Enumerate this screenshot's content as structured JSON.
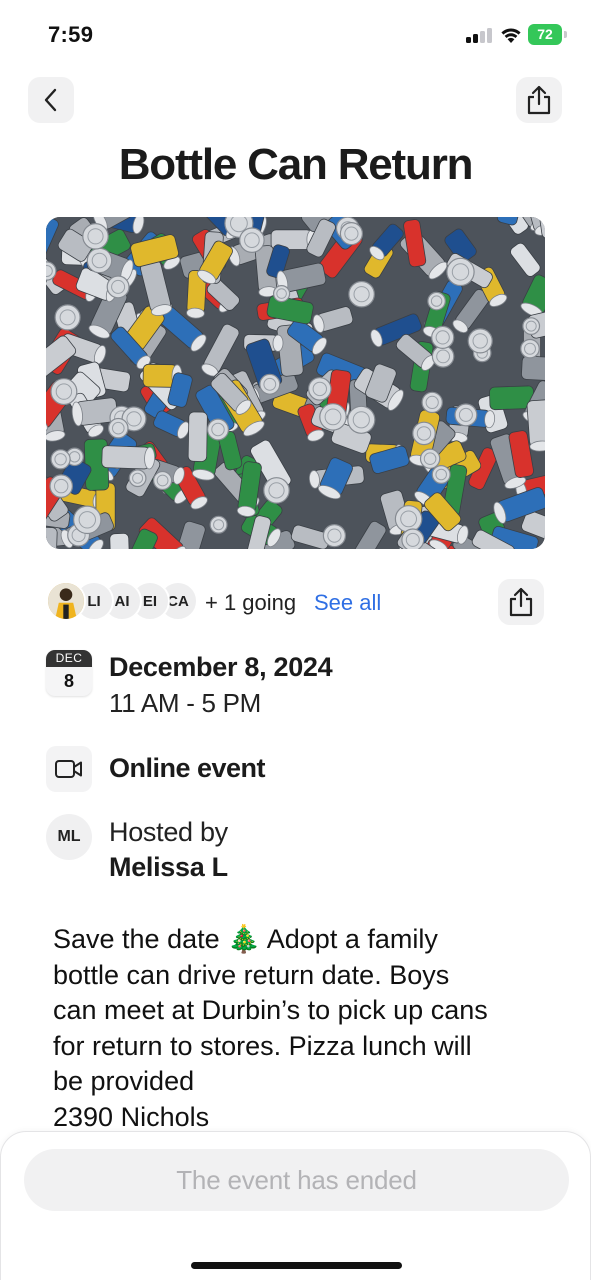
{
  "status_bar": {
    "time": "7:59",
    "battery": "72",
    "battery_color": "#34c759",
    "icons": [
      "signal-icon",
      "wifi-icon",
      "battery-icon"
    ]
  },
  "nav": {
    "back_icon": "chevron-left-icon",
    "share_icon": "share-icon"
  },
  "event": {
    "title": "Bottle Can Return",
    "hero_image": "pile of crushed aluminum soda cans"
  },
  "attendees": {
    "avatars": [
      "LI",
      "AI",
      "EI",
      "CA"
    ],
    "going": "+ 1 going",
    "see_all": "See all",
    "link_color": "#2f6fe4"
  },
  "date": {
    "badge_month": "DEC",
    "badge_day": "8",
    "full_date": "December 8, 2024",
    "time_range": "11 AM - 5 PM"
  },
  "location": {
    "icon": "video-camera-icon",
    "label": "Online event"
  },
  "host": {
    "initials": "ML",
    "label": "Hosted by",
    "name": "Melissa L"
  },
  "description": "Save the date 🎄 Adopt a family\nbottle can drive return date.  Boys\ncan meet at Durbin’s to pick up cans\nfor return to stores.  Pizza lunch will\nbe provided\n2390 Nichols",
  "footer": {
    "status_button": "The event has ended"
  }
}
